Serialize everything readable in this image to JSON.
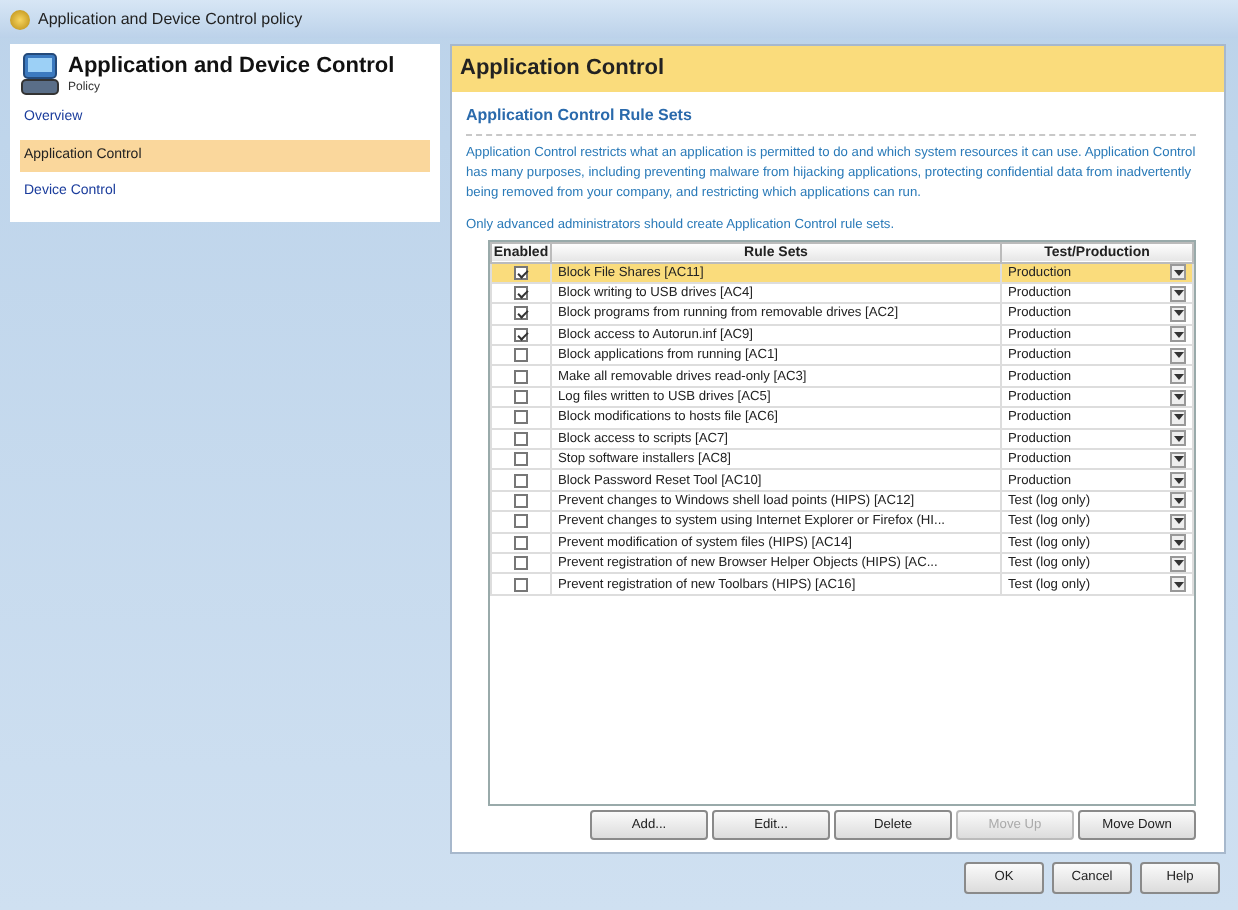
{
  "window": {
    "title": "Application and Device Control policy"
  },
  "sidebar": {
    "title": "Application and Device Control",
    "subtitle": "Policy",
    "items": [
      {
        "label": "Overview",
        "selected": false
      },
      {
        "label": "Application Control",
        "selected": true
      },
      {
        "label": "Device Control",
        "selected": false
      }
    ]
  },
  "panel": {
    "title": "Application Control",
    "section_title": "Application Control Rule Sets",
    "description": "Application Control restricts what an application is permitted to do and which system resources it can use. Application Control has many purposes, including preventing malware from hijacking applications, protecting confidential data from inadvertently being removed from your company, and restricting which applications can run.",
    "note": "Only advanced administrators should create Application Control rule sets."
  },
  "table": {
    "columns": [
      "Enabled",
      "Rule Sets",
      "Test/Production"
    ],
    "rows": [
      {
        "checked": true,
        "name": "Block File Shares [AC11]",
        "mode": "Production",
        "selected": true
      },
      {
        "checked": true,
        "name": "Block writing to USB drives [AC4]",
        "mode": "Production",
        "selected": false
      },
      {
        "checked": true,
        "name": "Block programs from running from removable drives [AC2]",
        "mode": "Production",
        "selected": false
      },
      {
        "checked": true,
        "name": "Block access to Autorun.inf [AC9]",
        "mode": "Production",
        "selected": false
      },
      {
        "checked": false,
        "name": "Block applications from running [AC1]",
        "mode": "Production",
        "selected": false
      },
      {
        "checked": false,
        "name": "Make all removable drives read-only [AC3]",
        "mode": "Production",
        "selected": false
      },
      {
        "checked": false,
        "name": "Log files written to USB drives [AC5]",
        "mode": "Production",
        "selected": false
      },
      {
        "checked": false,
        "name": "Block modifications to hosts file [AC6]",
        "mode": "Production",
        "selected": false
      },
      {
        "checked": false,
        "name": "Block access to scripts [AC7]",
        "mode": "Production",
        "selected": false
      },
      {
        "checked": false,
        "name": "Stop software installers [AC8]",
        "mode": "Production",
        "selected": false
      },
      {
        "checked": false,
        "name": "Block Password Reset Tool [AC10]",
        "mode": "Production",
        "selected": false
      },
      {
        "checked": false,
        "name": "Prevent changes to Windows shell load points (HIPS) [AC12]",
        "mode": "Test (log only)",
        "selected": false
      },
      {
        "checked": false,
        "name": "Prevent changes to system using Internet Explorer or Firefox (HI...",
        "mode": "Test (log only)",
        "selected": false
      },
      {
        "checked": false,
        "name": "Prevent modification of system files (HIPS) [AC14]",
        "mode": "Test (log only)",
        "selected": false
      },
      {
        "checked": false,
        "name": "Prevent registration of new Browser Helper Objects (HIPS) [AC...",
        "mode": "Test (log only)",
        "selected": false
      },
      {
        "checked": false,
        "name": "Prevent registration of new Toolbars (HIPS) [AC16]",
        "mode": "Test (log only)",
        "selected": false
      }
    ]
  },
  "table_buttons": [
    {
      "label": "Add...",
      "disabled": false
    },
    {
      "label": "Edit...",
      "disabled": false
    },
    {
      "label": "Delete",
      "disabled": false
    },
    {
      "label": "Move Up",
      "disabled": true
    },
    {
      "label": "Move Down",
      "disabled": false
    }
  ],
  "dialog_buttons": [
    "OK",
    "Cancel",
    "Help"
  ]
}
